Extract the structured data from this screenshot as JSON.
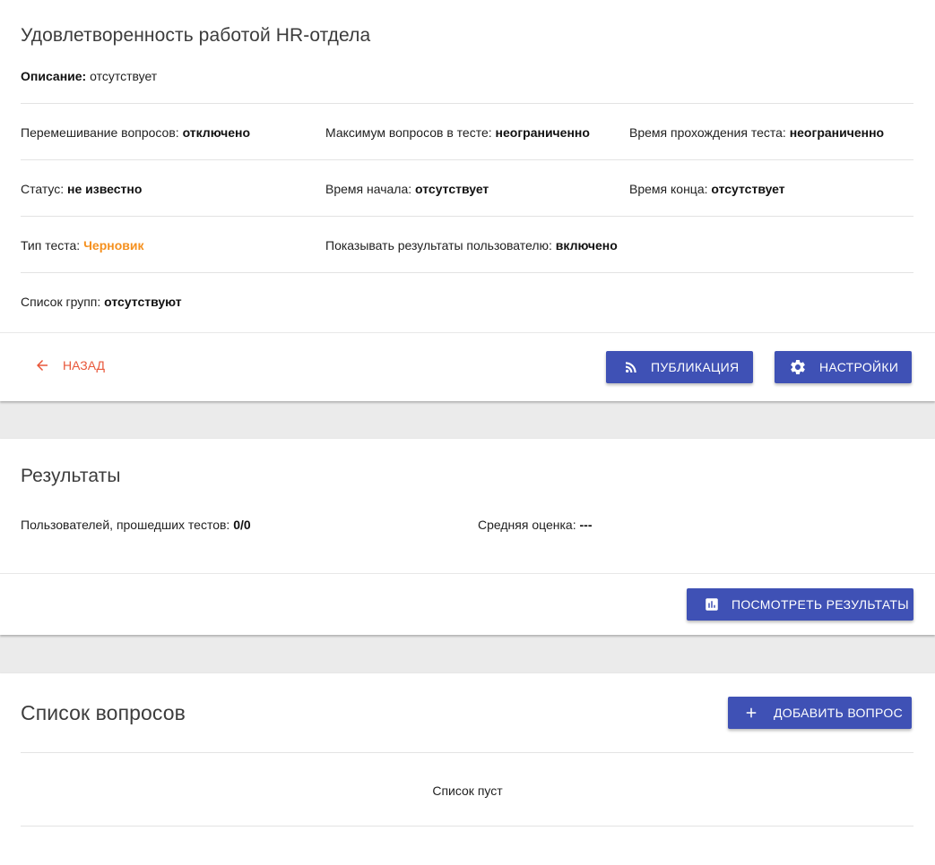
{
  "test": {
    "title": "Удовлетворенность работой HR-отдела",
    "description_label": "Описание:",
    "description_value": " отсутствует",
    "rows": [
      [
        {
          "label": "Перемешивание вопросов: ",
          "value": "отключено"
        },
        {
          "label": "Максимум вопросов в тесте: ",
          "value": "неограниченно"
        },
        {
          "label": "Время прохождения теста: ",
          "value": "неограниченно"
        }
      ],
      [
        {
          "label": "Статус: ",
          "value": "не известно"
        },
        {
          "label": "Время начала: ",
          "value": "отсутствует"
        },
        {
          "label": "Время конца: ",
          "value": "отсутствует"
        }
      ],
      [
        {
          "label": "Тип теста: ",
          "value": "Черновик"
        },
        {
          "label": "Показывать результаты пользователю: ",
          "value": "включено"
        }
      ],
      [
        {
          "label": "Список групп: ",
          "value": "отсутствуют"
        }
      ]
    ],
    "back_label": "Назад",
    "publish_label": "Публикация",
    "settings_label": "Настройки"
  },
  "results": {
    "title": "Результаты",
    "users_label": "Пользователей, прошедших тестов: ",
    "users_value": "0/0",
    "avg_label": "Средняя оценка: ",
    "avg_value": "---",
    "view_label": "Посмотреть результаты"
  },
  "questions": {
    "title": "Список вопросов",
    "add_label": "Добавить вопрос",
    "empty_text": "Список пуст"
  },
  "colors": {
    "primary": "#3f51b5",
    "accent_draft": "#f5901e",
    "back_link": "#e8573a"
  },
  "icons": {
    "back": "arrow-left-icon",
    "publish": "rss-feed-icon",
    "settings": "gear-icon",
    "view_results": "bar-chart-icon",
    "add": "plus-icon"
  }
}
